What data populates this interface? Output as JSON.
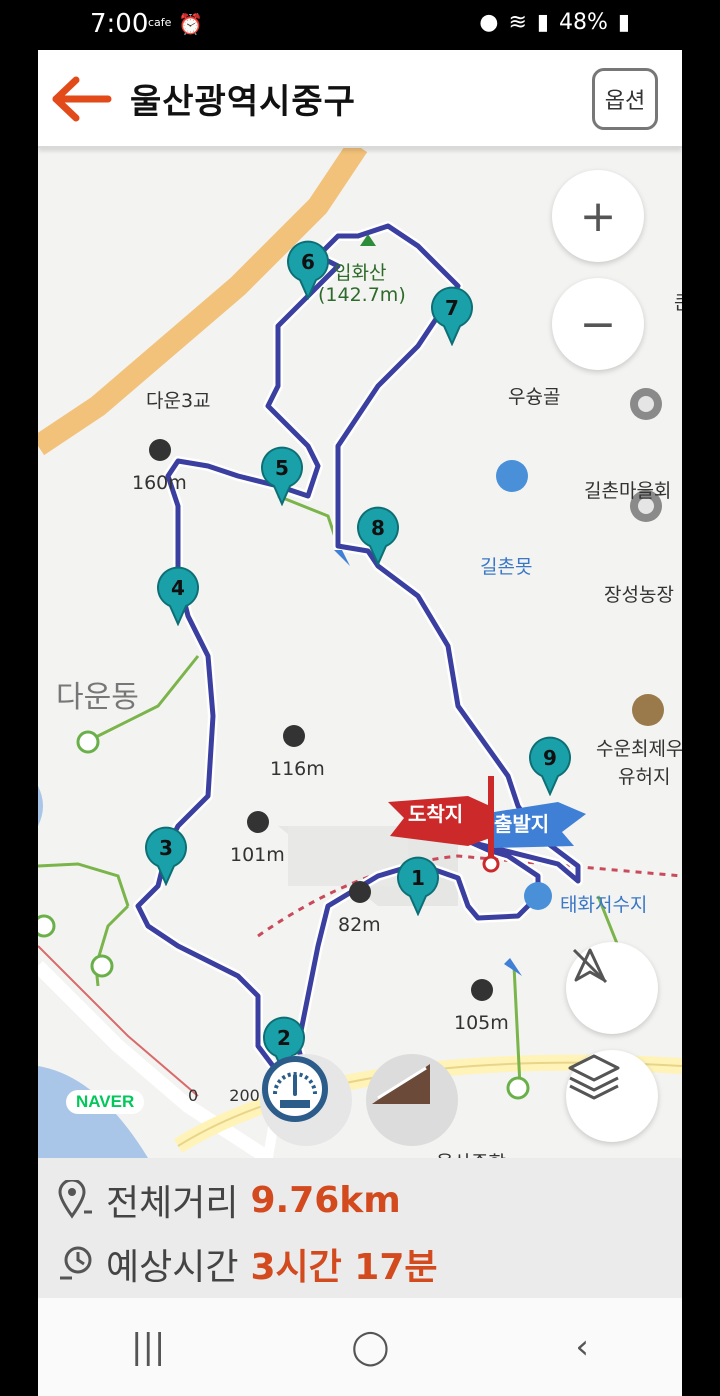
{
  "status_bar": {
    "time": "7:00",
    "notif_label": "cafe",
    "battery": "48%"
  },
  "header": {
    "title": "울산광역시중구",
    "option_label": "옵션"
  },
  "map": {
    "places": [
      {
        "name": "큰골"
      },
      {
        "name": "우슝골"
      },
      {
        "name": "길촌마을회"
      },
      {
        "name": "길촌못"
      },
      {
        "name": "장성농장"
      },
      {
        "name": "다운3교"
      },
      {
        "name": "다운동"
      },
      {
        "name": "수운최제우"
      },
      {
        "name": "유허지"
      },
      {
        "name": "태화저수지"
      },
      {
        "name": "울산종합"
      }
    ],
    "peaks": {
      "summit_name": "입화산",
      "summit_height": "(142.7m)",
      "p160": "160m",
      "p116": "116m",
      "p101": "101m",
      "p82": "82m",
      "p105": "105m"
    },
    "flags": {
      "finish": "도착지",
      "start": "출발지"
    },
    "waypoints": [
      "1",
      "2",
      "3",
      "4",
      "5",
      "6",
      "7",
      "8",
      "9"
    ],
    "logo": "NAVER",
    "scale": {
      "zero": "0",
      "value": "200"
    }
  },
  "route_info": {
    "distance_label": "전체거리",
    "distance_value": "9.76km",
    "time_label": "예상시간",
    "time_value": "3시간 17분"
  }
}
